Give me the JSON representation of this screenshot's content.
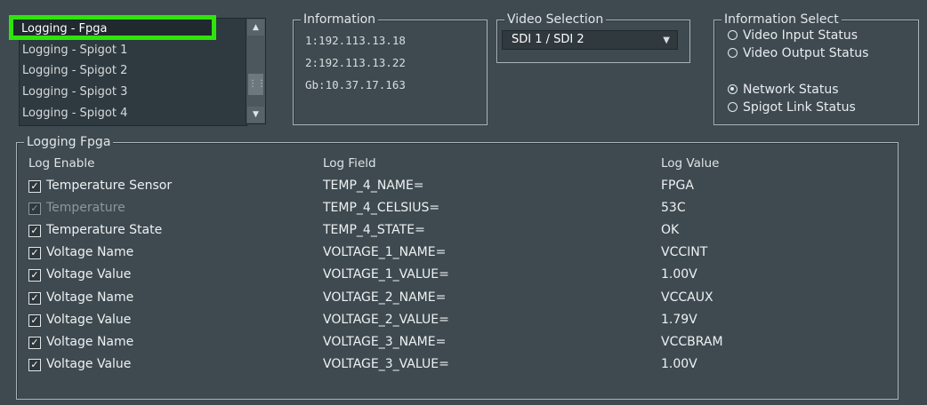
{
  "log_list": {
    "items": [
      {
        "label": "Logging - Fpga",
        "selected": true
      },
      {
        "label": "Logging - Spigot 1",
        "selected": false
      },
      {
        "label": "Logging - Spigot 2",
        "selected": false
      },
      {
        "label": "Logging - Spigot 3",
        "selected": false
      },
      {
        "label": "Logging - Spigot 4",
        "selected": false
      }
    ],
    "highlight_color": "#2fe40c"
  },
  "information": {
    "title": "Information",
    "lines": [
      "1:192.113.13.18",
      "2:192.113.13.22",
      "Gb:10.37.17.163"
    ]
  },
  "video_selection": {
    "title": "Video Selection",
    "value": "SDI 1 / SDI 2"
  },
  "information_select": {
    "title": "Information Select",
    "options": [
      {
        "label": "Video Input Status",
        "selected": false
      },
      {
        "label": "Video Output Status",
        "selected": false
      },
      {
        "label": "Network Status",
        "selected": true
      },
      {
        "label": "Spigot Link Status",
        "selected": false
      }
    ]
  },
  "logging_fpga": {
    "title": "Logging Fpga",
    "headers": {
      "enable": "Log Enable",
      "field": "Log Field",
      "value": "Log Value"
    },
    "rows": [
      {
        "label": "Temperature Sensor",
        "field": "TEMP_4_NAME=",
        "value": "FPGA",
        "checked": true,
        "enabled": true
      },
      {
        "label": "Temperature",
        "field": "TEMP_4_CELSIUS=",
        "value": "53C",
        "checked": true,
        "enabled": false
      },
      {
        "label": "Temperature State",
        "field": "TEMP_4_STATE=",
        "value": "OK",
        "checked": true,
        "enabled": true
      },
      {
        "label": "Voltage Name",
        "field": "VOLTAGE_1_NAME=",
        "value": "VCCINT",
        "checked": true,
        "enabled": true
      },
      {
        "label": "Voltage Value",
        "field": "VOLTAGE_1_VALUE=",
        "value": "1.00V",
        "checked": true,
        "enabled": true
      },
      {
        "label": "Voltage Name",
        "field": "VOLTAGE_2_NAME=",
        "value": "VCCAUX",
        "checked": true,
        "enabled": true
      },
      {
        "label": "Voltage Value",
        "field": "VOLTAGE_2_VALUE=",
        "value": "1.79V",
        "checked": true,
        "enabled": true
      },
      {
        "label": "Voltage Name",
        "field": "VOLTAGE_3_NAME=",
        "value": "VCCBRAM",
        "checked": true,
        "enabled": true
      },
      {
        "label": "Voltage Value",
        "field": "VOLTAGE_3_VALUE=",
        "value": "1.00V",
        "checked": true,
        "enabled": true
      }
    ]
  }
}
